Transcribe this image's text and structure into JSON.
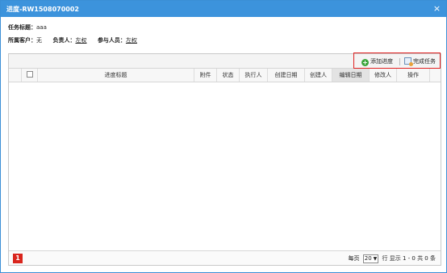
{
  "window": {
    "title": "进度-RW1508070002",
    "close_glyph": "×"
  },
  "task": {
    "title_label": "任务标题：",
    "title_value": "aaa"
  },
  "meta": {
    "customer_label": "所属客户：",
    "customer_value": "无",
    "owner_label": "负责人：",
    "owner_value": "左权",
    "participants_label": "参与人员：",
    "participants_value": "左权"
  },
  "toolbar": {
    "add_label": "添加进度",
    "add_icon": "plus-circle-icon",
    "complete_label": "完成任务",
    "complete_icon": "task-complete-icon",
    "highlight_color": "#e02020"
  },
  "table": {
    "columns": [
      "进度标题",
      "附件",
      "状态",
      "执行人",
      "创建日期",
      "创建人",
      "编辑日期",
      "修改人",
      "操作"
    ],
    "sorted_column": "编辑日期",
    "rows": []
  },
  "pager": {
    "current_page": "1",
    "per_page_label": "每页",
    "per_page_value": "20",
    "rows_label": "行",
    "summary": "显示 1 - 0 共 0 条"
  },
  "colors": {
    "titlebar": "#3c93dc",
    "page_badge": "#d9251d"
  }
}
